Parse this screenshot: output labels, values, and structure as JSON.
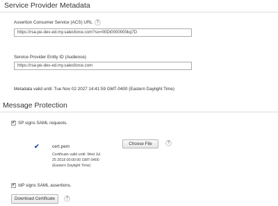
{
  "metadata_section": {
    "title": "Service Provider Metadata",
    "acs_label": "Assertion Consumer Service (ACS) URL",
    "acs_value": "https://rsa-pe-dev-ed.my.salesforce.com?so=00Di0000000kq7D",
    "entity_label": "Service Provider Entity ID (Audience)",
    "entity_value": "https://rsa-pe-dev-ed.my.salesforce.com",
    "valid_until": "Metadata valid until: Tue Nov 02 2027 14:41:59 GMT-0400 (Eastern Daylight Time)",
    "help_glyph": "?"
  },
  "protection_section": {
    "title": "Message Protection",
    "sp_signs_label": "SP signs SAML requests.",
    "sp_signs_checked": true,
    "check_glyph": "✔",
    "cert_name": "cert.pem",
    "cert_valid": "Certificate valid until: Wed Jul 25 2018 00:00:00 GMT-0400 (Eastern Daylight Time)",
    "choose_file_label": "Choose File",
    "idp_signs_label": "IdP signs SAML assertions.",
    "idp_signs_checked": true,
    "download_label": "Download Certificate",
    "help_glyph": "?"
  },
  "colors": {
    "accent_check": "#1a4f9c",
    "text": "#333333",
    "rule": "#dddddd"
  },
  "icons": [
    "help-icon",
    "checkmark-icon"
  ]
}
